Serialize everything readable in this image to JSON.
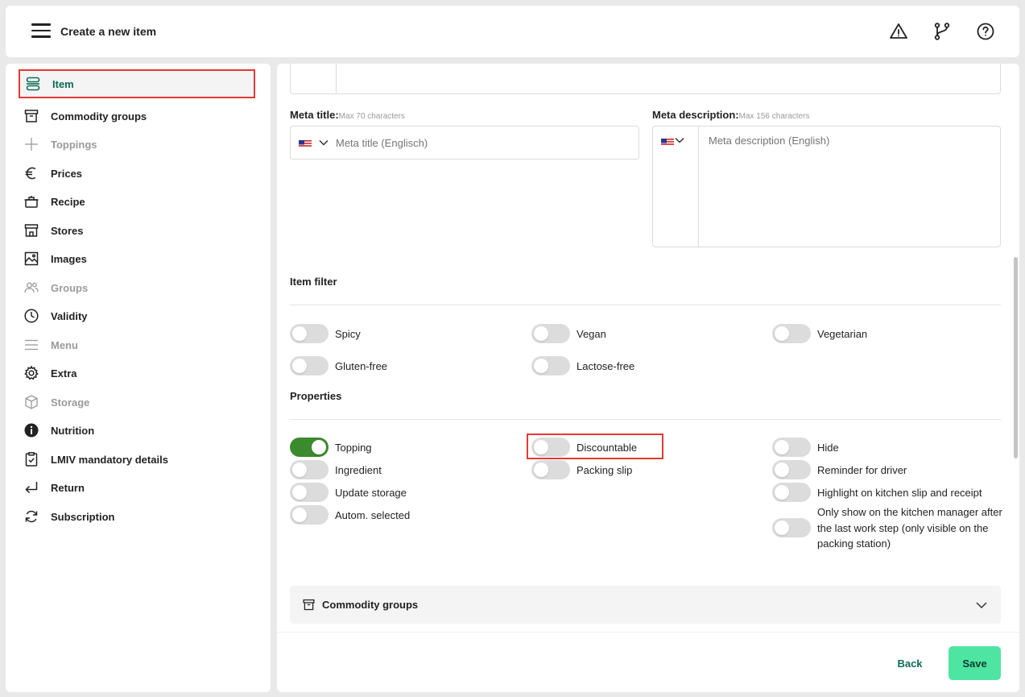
{
  "header": {
    "title": "Create a new item",
    "icons": [
      "menu-icon",
      "warning-icon",
      "branch-icon",
      "help-icon"
    ]
  },
  "sidebar": {
    "items": [
      {
        "label": "Item",
        "icon": "item-icon",
        "state": "active"
      },
      {
        "label": "Commodity groups",
        "icon": "archive-icon",
        "state": "enabled"
      },
      {
        "label": "Toppings",
        "icon": "plus-icon",
        "state": "disabled"
      },
      {
        "label": "Prices",
        "icon": "euro-icon",
        "state": "enabled"
      },
      {
        "label": "Recipe",
        "icon": "pot-icon",
        "state": "enabled"
      },
      {
        "label": "Stores",
        "icon": "store-icon",
        "state": "enabled"
      },
      {
        "label": "Images",
        "icon": "image-icon",
        "state": "enabled"
      },
      {
        "label": "Groups",
        "icon": "users-icon",
        "state": "disabled"
      },
      {
        "label": "Validity",
        "icon": "clock-icon",
        "state": "enabled"
      },
      {
        "label": "Menu",
        "icon": "list-icon",
        "state": "disabled"
      },
      {
        "label": "Extra",
        "icon": "gear-icon",
        "state": "enabled"
      },
      {
        "label": "Storage",
        "icon": "box-icon",
        "state": "disabled"
      },
      {
        "label": "Nutrition",
        "icon": "info-icon",
        "state": "enabled"
      },
      {
        "label": "LMIV mandatory details",
        "icon": "clipboard-check-icon",
        "state": "enabled"
      },
      {
        "label": "Return",
        "icon": "return-icon",
        "state": "enabled"
      },
      {
        "label": "Subscription",
        "icon": "refresh-icon",
        "state": "enabled"
      }
    ]
  },
  "form": {
    "meta_title": {
      "label": "Meta title:",
      "hint": "Max 70 characters",
      "placeholder": "Meta title (Englisch)",
      "value": ""
    },
    "meta_description": {
      "label": "Meta description:",
      "hint": "Max 156 characters",
      "placeholder": "Meta description (English)",
      "value": ""
    },
    "item_filter": {
      "title": "Item filter",
      "toggles": [
        {
          "label": "Spicy",
          "on": false
        },
        {
          "label": "Vegan",
          "on": false
        },
        {
          "label": "Vegetarian",
          "on": false
        },
        {
          "label": "Gluten-free",
          "on": false
        },
        {
          "label": "Lactose-free",
          "on": false
        }
      ]
    },
    "properties": {
      "title": "Properties",
      "toggles": [
        {
          "label": "Topping",
          "on": true
        },
        {
          "label": "Discountable",
          "on": false
        },
        {
          "label": "Hide",
          "on": false
        },
        {
          "label": "Ingredient",
          "on": false
        },
        {
          "label": "Packing slip",
          "on": false
        },
        {
          "label": "Reminder for driver",
          "on": false
        },
        {
          "label": "Update storage",
          "on": false
        },
        {
          "label": "Highlight on kitchen slip and receipt",
          "on": false
        },
        {
          "label": "Autom. selected",
          "on": false
        },
        {
          "label": "Only show on the kitchen manager after the last work step (only visible on the packing station)",
          "on": false
        }
      ]
    },
    "accordion": {
      "label": "Commodity groups",
      "icon": "archive-icon"
    }
  },
  "footer": {
    "back_label": "Back",
    "save_label": "Save"
  },
  "colors": {
    "accent": "#0e6b55",
    "save": "#4ee5a3",
    "toggle_on": "#3b8a2e",
    "highlight": "#e53935"
  }
}
